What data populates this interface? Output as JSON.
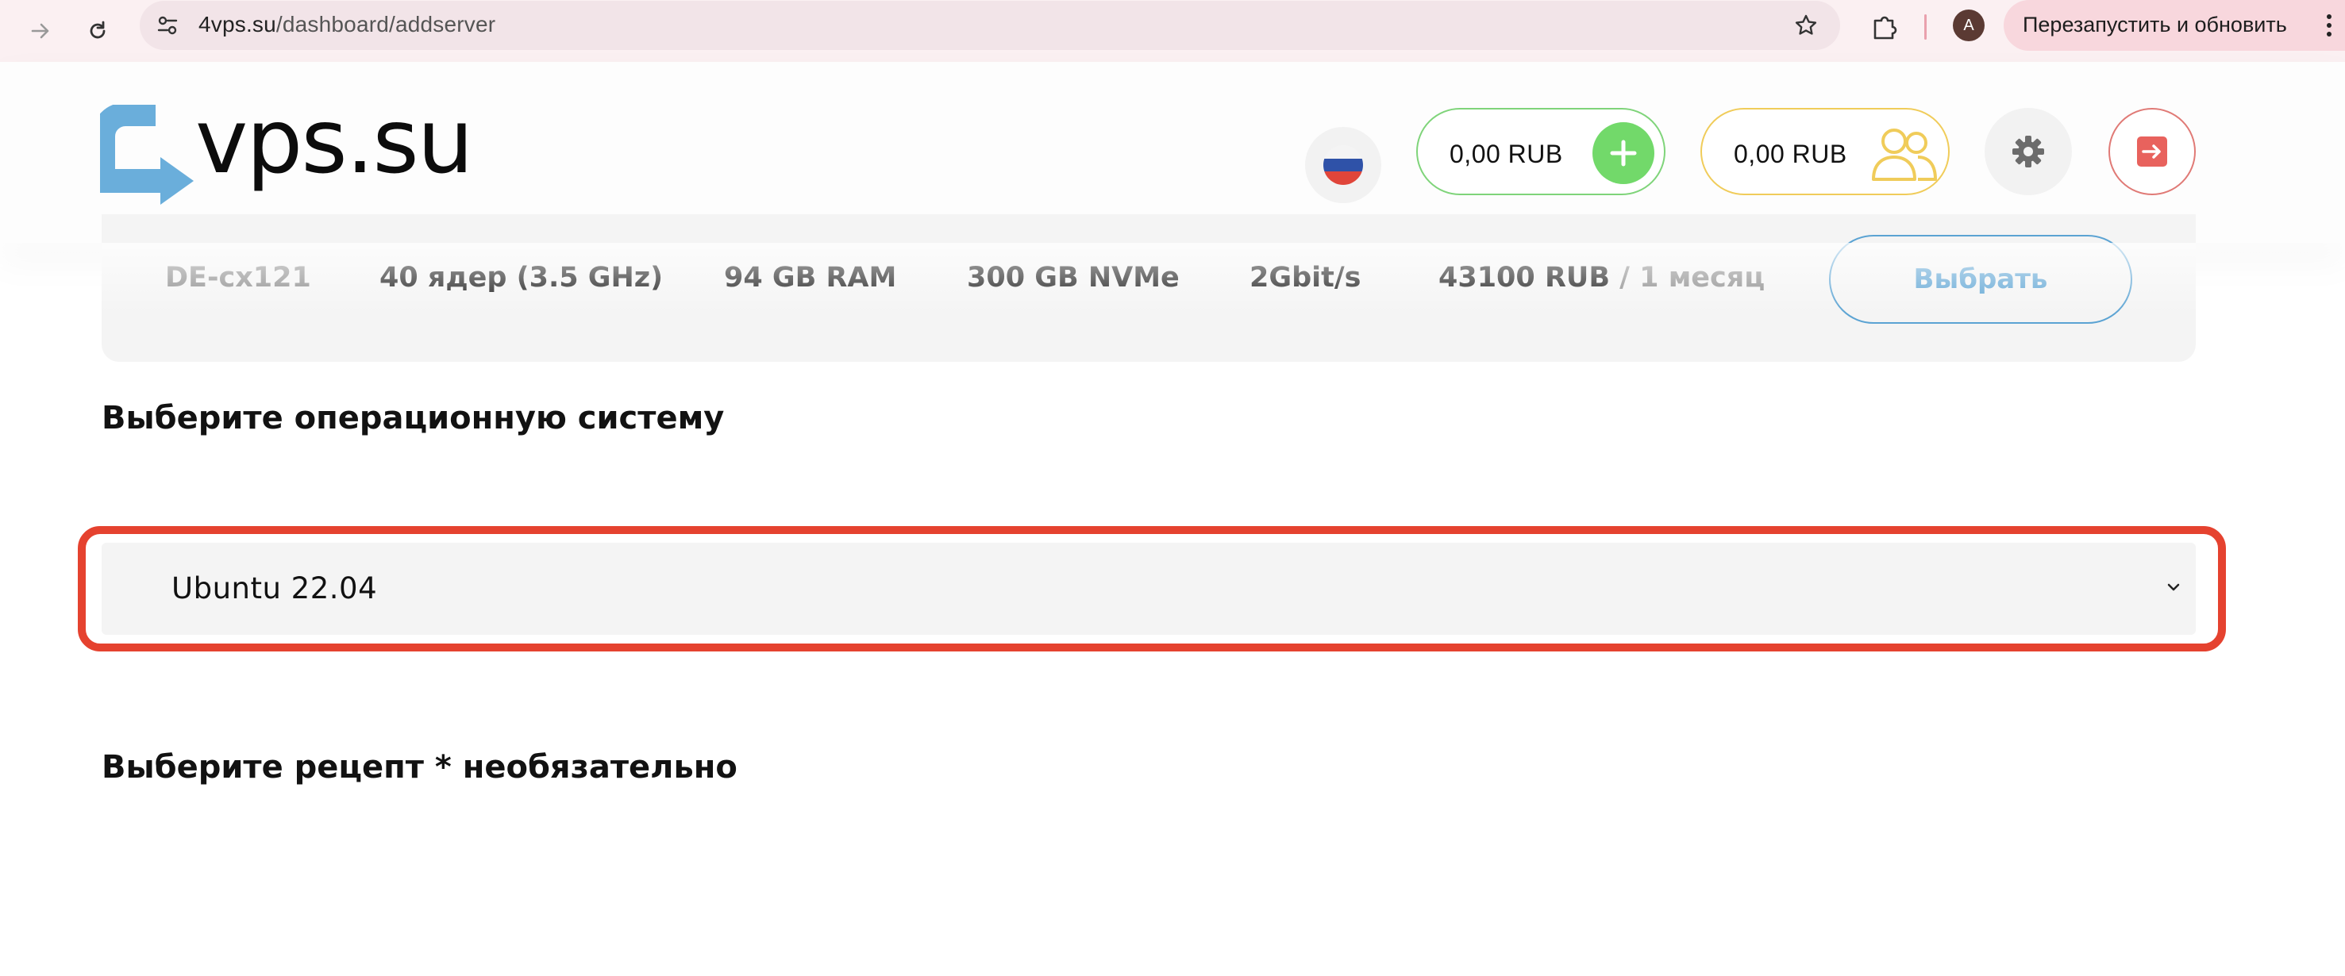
{
  "browser": {
    "url_host": "4vps.su",
    "url_path": "/dashboard/addserver",
    "profile_initial": "A",
    "restart_label": "Перезапустить и обновить"
  },
  "header": {
    "logo_text": "vps.su",
    "balance": "0,00 RUB",
    "referral_balance": "0,00 RUB",
    "colors": {
      "balance_accent": "#72d96a",
      "referral_accent": "#f0cc5a",
      "logout_accent": "#e07a76",
      "logo_blue": "#6aaedb"
    }
  },
  "plan": {
    "name": "DE-cx121",
    "cpu": "40 ядер (3.5 GHz)",
    "ram": "94 GB RAM",
    "disk": "300 GB NVMe",
    "network": "2Gbit/s",
    "price": "43100 RUB",
    "period": " / 1 месяц",
    "select_label": "Выбрать"
  },
  "os_section": {
    "title": "Выберите операционную систему",
    "selected": "Ubuntu 22.04"
  },
  "recipe_section": {
    "title": "Выберите рецепт * необязательно"
  },
  "colors": {
    "highlight": "#e5422f",
    "select_button": "#5ba3d3"
  }
}
